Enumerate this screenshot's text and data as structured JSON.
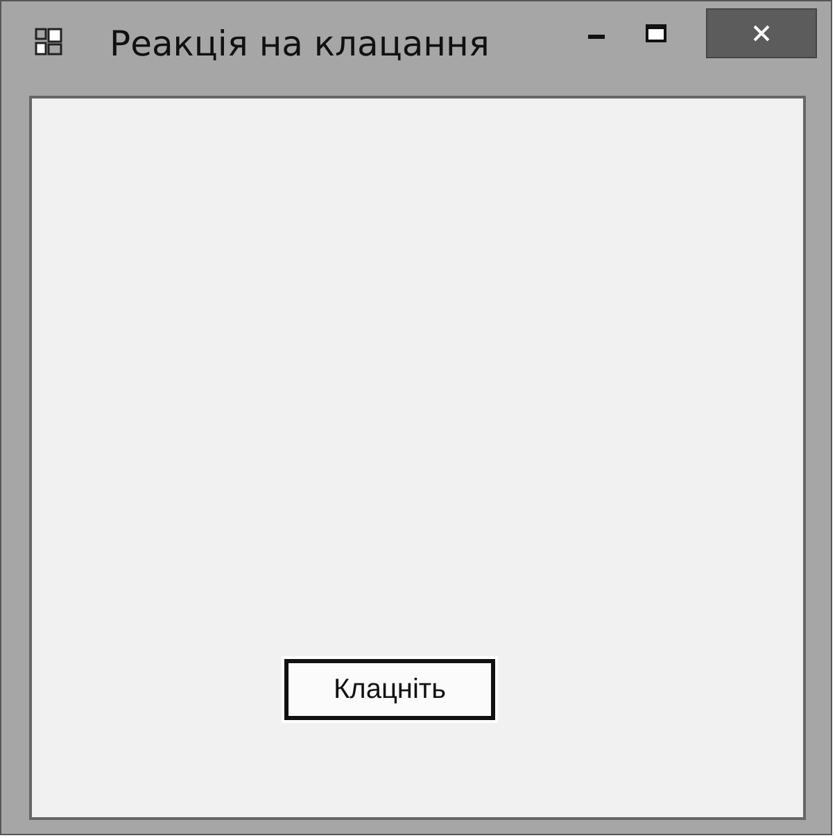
{
  "window": {
    "title": "Реакція на клацання"
  },
  "button": {
    "label": "Клацніть"
  }
}
